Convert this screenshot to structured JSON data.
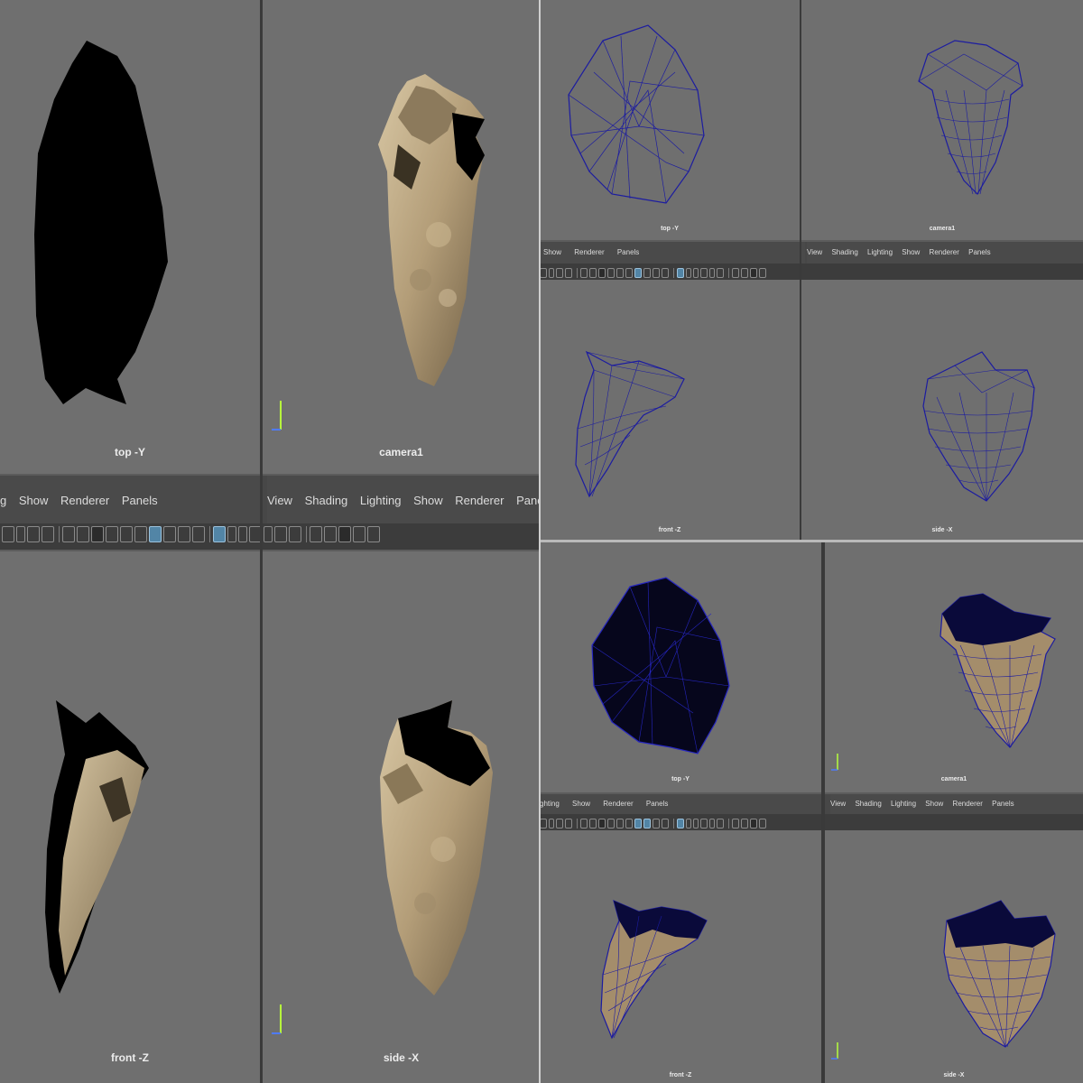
{
  "panels": {
    "big": {
      "top": {
        "label": "top -Y"
      },
      "camera": {
        "label": "camera1"
      },
      "front": {
        "label": "front -Z"
      },
      "side": {
        "label": "side -X"
      },
      "menu_left": [
        "g",
        "Show",
        "Renderer",
        "Panels"
      ],
      "menu_right": [
        "View",
        "Shading",
        "Lighting",
        "Show",
        "Renderer",
        "Panels"
      ]
    },
    "wire": {
      "top": {
        "label": "top -Y"
      },
      "camera": {
        "label": "camera1"
      },
      "front": {
        "label": "front -Z"
      },
      "side": {
        "label": "side -X"
      },
      "menu_left": [
        "Show",
        "Renderer",
        "Panels"
      ],
      "menu_right": [
        "View",
        "Shading",
        "Lighting",
        "Show",
        "Renderer",
        "Panels"
      ]
    },
    "wireshaded": {
      "top": {
        "label": "top -Y"
      },
      "camera": {
        "label": "camera1"
      },
      "front": {
        "label": "front -Z"
      },
      "side": {
        "label": "side -X"
      },
      "menu_left": [
        "ghting",
        "Show",
        "Renderer",
        "Panels"
      ],
      "menu_right": [
        "View",
        "Shading",
        "Lighting",
        "Show",
        "Renderer",
        "Panels"
      ]
    }
  },
  "axis_labels": {
    "y": "y",
    "z": "z"
  },
  "colors": {
    "viewport_bg": "#6f6f6f",
    "wire": "#1c1ca0",
    "tan": "#b5a07e",
    "selected": "#5285a6"
  }
}
